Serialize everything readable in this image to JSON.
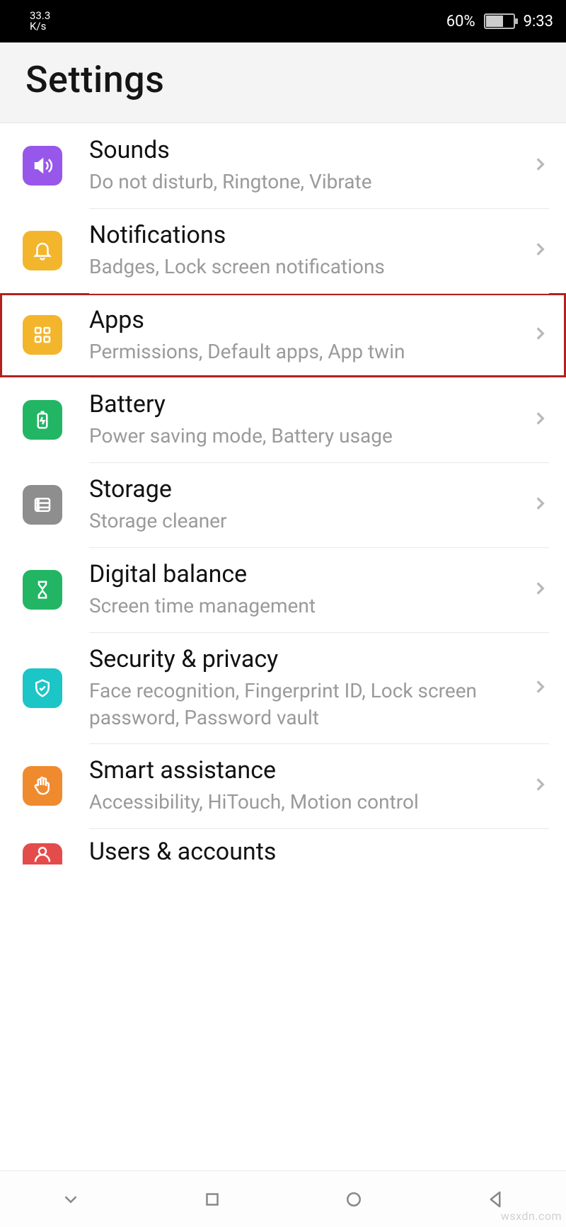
{
  "status": {
    "network_speed_value": "33.3",
    "network_speed_unit": "K/s",
    "battery_percent_text": "60%",
    "battery_level": 60,
    "clock": "9:33"
  },
  "header": {
    "title": "Settings"
  },
  "rows": {
    "sounds": {
      "title": "Sounds",
      "subtitle": "Do not disturb, Ringtone, Vibrate",
      "icon_color": "#9757ea"
    },
    "notifications": {
      "title": "Notifications",
      "subtitle": "Badges, Lock screen notifications",
      "icon_color": "#f3b52b"
    },
    "apps": {
      "title": "Apps",
      "subtitle": "Permissions, Default apps, App twin",
      "icon_color": "#f3b52b",
      "highlighted": true
    },
    "battery": {
      "title": "Battery",
      "subtitle": "Power saving mode, Battery usage",
      "icon_color": "#22b664"
    },
    "storage": {
      "title": "Storage",
      "subtitle": "Storage cleaner",
      "icon_color": "#8e8e8e"
    },
    "digital_balance": {
      "title": "Digital balance",
      "subtitle": "Screen time management",
      "icon_color": "#22b664"
    },
    "security_privacy": {
      "title": "Security & privacy",
      "subtitle": "Face recognition, Fingerprint ID, Lock screen password, Password vault",
      "icon_color": "#1cc5c6"
    },
    "smart_assistance": {
      "title": "Smart assistance",
      "subtitle": "Accessibility, HiTouch, Motion control",
      "icon_color": "#f08a2e"
    },
    "users_accounts": {
      "title": "Users & accounts",
      "subtitle": "",
      "icon_color": "#e44b4b"
    }
  },
  "watermark": "wsxdn.com"
}
